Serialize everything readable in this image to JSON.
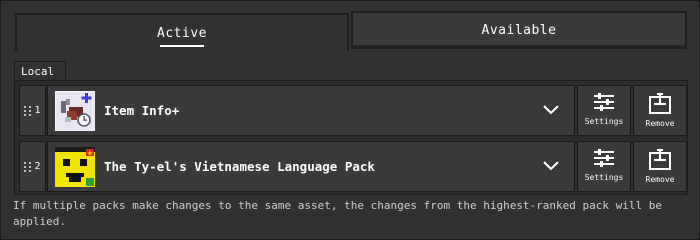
{
  "tabs": {
    "active_label": "Active",
    "available_label": "Available"
  },
  "section_label": "Local",
  "packs": [
    {
      "rank": "1",
      "title": "Item Info+",
      "icon": "item-info-plus-icon"
    },
    {
      "rank": "2",
      "title": "The Ty-el's Vietnamese Language Pack",
      "icon": "yellow-face-vietnam-icon"
    }
  ],
  "buttons": {
    "settings_label": "Settings",
    "remove_label": "Remove"
  },
  "footer_text": "If multiple packs make changes to the same asset, the changes from the highest-ranked pack will be applied.",
  "colors": {
    "background": "#313131",
    "panel": "#3a3a3a",
    "border": "#1b1b1b",
    "text": "#ffffff"
  }
}
